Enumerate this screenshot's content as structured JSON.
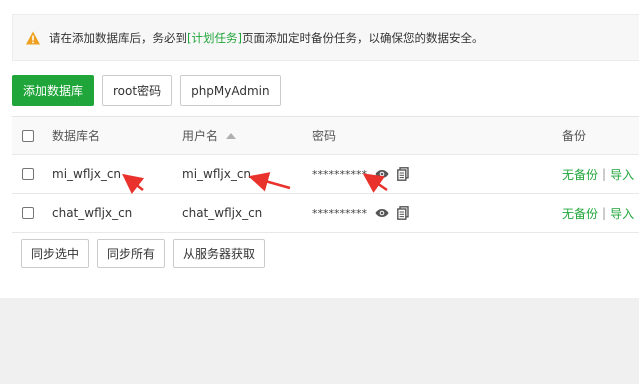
{
  "alert": {
    "icon": "warning-icon",
    "text_before": "请在添加数据库后，务必到",
    "link": "[计划任务]",
    "text_after": "页面添加定时备份任务，以确保您的数据安全。"
  },
  "toolbar": {
    "add_db": "添加数据库",
    "root_pw": "root密码",
    "phpmyadmin": "phpMyAdmin"
  },
  "table": {
    "headers": {
      "db": "数据库名",
      "user": "用户名",
      "password": "密码",
      "backup": "备份"
    },
    "sort_icon": "sort-asc-icon",
    "rows": [
      {
        "db": "mi_wfljx_cn",
        "user": "mi_wfljx_cn",
        "password": "**********",
        "backup": "无备份",
        "import": "导入"
      },
      {
        "db": "chat_wfljx_cn",
        "user": "chat_wfljx_cn",
        "password": "**********",
        "backup": "无备份",
        "import": "导入"
      }
    ],
    "separator": "|"
  },
  "footer": {
    "sync_selected": "同步选中",
    "sync_all": "同步所有",
    "fetch_server": "从服务器获取"
  },
  "colors": {
    "accent": "#20a53a",
    "warning": "#f0a020",
    "annotation": "#e8322b"
  }
}
